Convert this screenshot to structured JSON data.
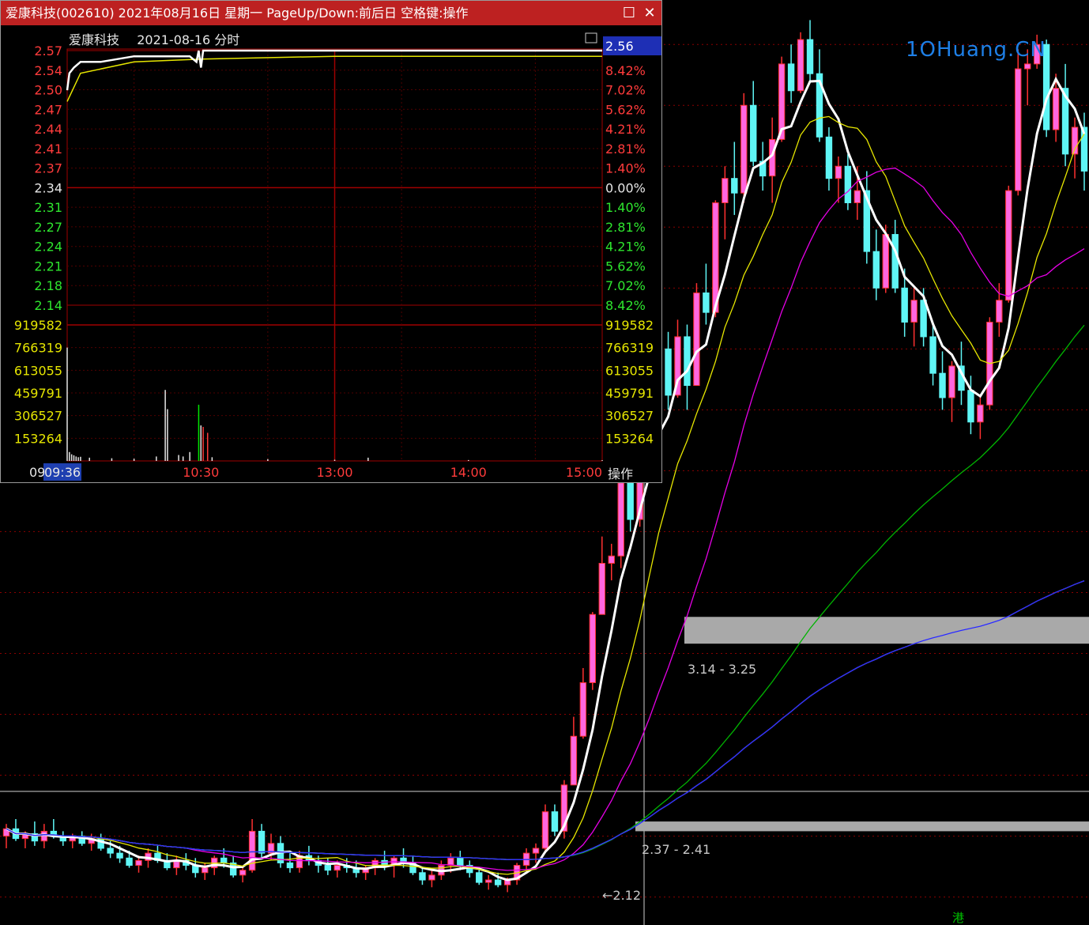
{
  "window": {
    "title": "爱康科技(002610) 2021年08月16日 星期一 PageUp/Down:前后日 空格键:操作",
    "maximize_icon": "maximize-icon",
    "close_icon": "close-icon"
  },
  "intraday": {
    "stock_name": "爱康科技",
    "date_label": "2021-08-16 分时",
    "current_price": "2.56",
    "operate_button": "操作",
    "prev_close": "2.34",
    "price_ticks_left": [
      "2.57",
      "2.54",
      "2.50",
      "2.47",
      "2.44",
      "2.41",
      "2.37",
      "2.34",
      "2.31",
      "2.27",
      "2.24",
      "2.21",
      "2.18",
      "2.14"
    ],
    "pct_ticks_right": [
      "8.42%",
      "7.02%",
      "5.62%",
      "4.21%",
      "2.81%",
      "1.40%",
      "0.00%",
      "1.40%",
      "2.81%",
      "4.21%",
      "5.62%",
      "7.02%",
      "8.42%"
    ],
    "volume_ticks": [
      "919582",
      "766319",
      "613055",
      "459791",
      "306527",
      "153264"
    ],
    "time_ticks": [
      "09",
      "09:36",
      "10:30",
      "13:00",
      "14:00",
      "15:00"
    ]
  },
  "kline": {
    "logo": "1OHuang.CN",
    "labels": {
      "band_high": "3.14 - 3.25",
      "band_low": "2.37 - 2.41",
      "low_marker": "←2.12",
      "hk_marker": "港"
    }
  },
  "colors": {
    "title_bar": "#bd2121",
    "up_candle": "#ff66e0",
    "down_candle": "#5ff5f5",
    "limit_up_candle": "#00e600",
    "grid": "#8b0000",
    "ma5": "#ffffff",
    "ma10": "#e6e600",
    "ma20": "#e600e6",
    "ma60": "#00b400",
    "ma120": "#c8c8c8",
    "ma250": "#2828ff",
    "price_line": "#ffffff",
    "avg_line": "#e6e600"
  },
  "chart_data": [
    {
      "type": "candlestick",
      "title": "",
      "series": [
        {
          "name": "candles",
          "ohlc": [
            [
              2.35,
              2.4,
              2.3,
              2.38
            ],
            [
              2.38,
              2.42,
              2.33,
              2.34
            ],
            [
              2.34,
              2.37,
              2.3,
              2.36
            ],
            [
              2.36,
              2.41,
              2.31,
              2.33
            ],
            [
              2.33,
              2.4,
              2.3,
              2.37
            ],
            [
              2.37,
              2.42,
              2.34,
              2.35
            ],
            [
              2.35,
              2.37,
              2.31,
              2.33
            ],
            [
              2.33,
              2.36,
              2.3,
              2.35
            ],
            [
              2.35,
              2.37,
              2.31,
              2.32
            ],
            [
              2.32,
              2.36,
              2.29,
              2.34
            ],
            [
              2.34,
              2.36,
              2.29,
              2.3
            ],
            [
              2.3,
              2.33,
              2.26,
              2.28
            ],
            [
              2.28,
              2.31,
              2.24,
              2.26
            ],
            [
              2.26,
              2.29,
              2.22,
              2.23
            ],
            [
              2.23,
              2.27,
              2.2,
              2.25
            ],
            [
              2.25,
              2.3,
              2.22,
              2.28
            ],
            [
              2.28,
              2.31,
              2.24,
              2.25
            ],
            [
              2.25,
              2.28,
              2.21,
              2.22
            ],
            [
              2.22,
              2.27,
              2.19,
              2.25
            ],
            [
              2.25,
              2.28,
              2.21,
              2.23
            ],
            [
              2.23,
              2.26,
              2.18,
              2.2
            ],
            [
              2.2,
              2.24,
              2.17,
              2.22
            ],
            [
              2.22,
              2.27,
              2.19,
              2.26
            ],
            [
              2.26,
              2.3,
              2.22,
              2.24
            ],
            [
              2.24,
              2.27,
              2.18,
              2.19
            ],
            [
              2.19,
              2.22,
              2.16,
              2.21
            ],
            [
              2.21,
              2.42,
              2.2,
              2.37
            ],
            [
              2.37,
              2.4,
              2.26,
              2.28
            ],
            [
              2.28,
              2.36,
              2.25,
              2.32
            ],
            [
              2.32,
              2.35,
              2.22,
              2.24
            ],
            [
              2.24,
              2.28,
              2.2,
              2.22
            ],
            [
              2.22,
              2.29,
              2.2,
              2.27
            ],
            [
              2.27,
              2.31,
              2.23,
              2.25
            ],
            [
              2.25,
              2.27,
              2.2,
              2.23
            ],
            [
              2.23,
              2.26,
              2.19,
              2.21
            ],
            [
              2.21,
              2.25,
              2.18,
              2.23
            ],
            [
              2.23,
              2.26,
              2.2,
              2.22
            ],
            [
              2.22,
              2.25,
              2.18,
              2.2
            ],
            [
              2.2,
              2.23,
              2.17,
              2.22
            ],
            [
              2.22,
              2.26,
              2.19,
              2.25
            ],
            [
              2.25,
              2.29,
              2.21,
              2.23
            ],
            [
              2.23,
              2.27,
              2.18,
              2.26
            ],
            [
              2.26,
              2.3,
              2.22,
              2.24
            ],
            [
              2.24,
              2.27,
              2.19,
              2.2
            ],
            [
              2.2,
              2.22,
              2.15,
              2.17
            ],
            [
              2.17,
              2.21,
              2.14,
              2.19
            ],
            [
              2.19,
              2.25,
              2.17,
              2.23
            ],
            [
              2.23,
              2.28,
              2.2,
              2.26
            ],
            [
              2.26,
              2.29,
              2.21,
              2.23
            ],
            [
              2.23,
              2.25,
              2.18,
              2.2
            ],
            [
              2.2,
              2.22,
              2.15,
              2.16
            ],
            [
              2.16,
              2.19,
              2.13,
              2.17
            ],
            [
              2.17,
              2.2,
              2.14,
              2.15
            ],
            [
              2.15,
              2.18,
              2.12,
              2.17
            ],
            [
              2.17,
              2.24,
              2.15,
              2.23
            ],
            [
              2.23,
              2.3,
              2.21,
              2.28
            ],
            [
              2.28,
              2.32,
              2.24,
              2.3
            ],
            [
              2.3,
              2.48,
              2.29,
              2.45
            ],
            [
              2.45,
              2.48,
              2.35,
              2.37
            ],
            [
              2.37,
              2.58,
              2.34,
              2.56
            ],
            [
              2.56,
              2.84,
              2.56,
              2.76
            ],
            [
              2.76,
              3.04,
              2.75,
              2.98
            ],
            [
              2.98,
              3.27,
              2.95,
              3.26
            ],
            [
              3.26,
              3.58,
              3.26,
              3.47
            ],
            [
              3.47,
              3.55,
              3.4,
              3.5
            ],
            [
              3.5,
              3.82,
              3.45,
              3.8
            ],
            [
              3.8,
              3.86,
              3.6,
              3.65
            ],
            [
              3.65,
              4.05,
              3.62,
              4.01
            ],
            [
              4.01,
              4.33,
              3.98,
              4.19
            ],
            [
              4.19,
              4.42,
              4.18,
              4.35
            ],
            [
              4.35,
              4.42,
              4.1,
              4.16
            ],
            [
              4.16,
              4.47,
              4.15,
              4.4
            ],
            [
              4.4,
              4.45,
              4.1,
              4.2
            ],
            [
              4.2,
              4.62,
              4.2,
              4.58
            ],
            [
              4.58,
              4.7,
              4.45,
              4.5
            ],
            [
              4.5,
              4.96,
              4.48,
              4.95
            ],
            [
              4.95,
              5.1,
              4.8,
              5.05
            ],
            [
              5.05,
              5.2,
              4.9,
              4.99
            ],
            [
              4.99,
              5.4,
              4.95,
              5.35
            ],
            [
              5.35,
              5.45,
              5.1,
              5.12
            ],
            [
              5.12,
              5.2,
              5.0,
              5.06
            ],
            [
              5.06,
              5.3,
              4.95,
              5.21
            ],
            [
              5.21,
              5.55,
              5.2,
              5.52
            ],
            [
              5.52,
              5.6,
              5.36,
              5.41
            ],
            [
              5.41,
              5.65,
              5.4,
              5.62
            ],
            [
              5.62,
              5.7,
              5.45,
              5.48
            ],
            [
              5.48,
              5.58,
              5.2,
              5.22
            ],
            [
              5.22,
              5.26,
              5.0,
              5.05
            ],
            [
              5.05,
              5.14,
              4.95,
              5.1
            ],
            [
              5.1,
              5.15,
              4.92,
              4.95
            ],
            [
              4.95,
              5.1,
              4.88,
              5.0
            ],
            [
              5.0,
              5.08,
              4.7,
              4.75
            ],
            [
              4.75,
              4.84,
              4.55,
              4.6
            ],
            [
              4.6,
              4.86,
              4.58,
              4.82
            ],
            [
              4.82,
              4.88,
              4.58,
              4.6
            ],
            [
              4.6,
              4.68,
              4.4,
              4.46
            ],
            [
              4.46,
              4.6,
              4.36,
              4.55
            ],
            [
              4.55,
              4.6,
              4.36,
              4.4
            ],
            [
              4.4,
              4.46,
              4.2,
              4.25
            ],
            [
              4.25,
              4.34,
              4.1,
              4.15
            ],
            [
              4.15,
              4.3,
              4.05,
              4.28
            ],
            [
              4.28,
              4.38,
              4.12,
              4.18
            ],
            [
              4.18,
              4.24,
              4.0,
              4.05
            ],
            [
              4.05,
              4.16,
              3.98,
              4.12
            ],
            [
              4.12,
              4.48,
              4.1,
              4.46
            ],
            [
              4.46,
              4.62,
              4.4,
              4.55
            ],
            [
              4.55,
              5.02,
              4.54,
              5.0
            ],
            [
              5.0,
              5.58,
              4.98,
              5.5
            ],
            [
              5.5,
              5.58,
              5.35,
              5.52
            ],
            [
              5.52,
              5.64,
              5.5,
              5.6
            ],
            [
              5.6,
              5.62,
              5.22,
              5.25
            ],
            [
              5.25,
              5.48,
              5.2,
              5.42
            ],
            [
              5.42,
              5.52,
              5.1,
              5.15
            ],
            [
              5.15,
              5.3,
              5.05,
              5.26
            ],
            [
              5.26,
              5.32,
              5.0,
              5.08
            ]
          ]
        }
      ],
      "moving_averages": [
        {
          "period": 5,
          "color": "#ffffff"
        },
        {
          "period": 10,
          "color": "#e6e600"
        },
        {
          "period": 20,
          "color": "#e600e6"
        },
        {
          "period": 60,
          "color": "#00b400"
        },
        {
          "period": 120,
          "color": "#c8c8c8"
        },
        {
          "period": 250,
          "color": "#2828ff"
        }
      ],
      "price_bands": [
        {
          "low": 3.14,
          "high": 3.25,
          "label": "3.14 - 3.25"
        },
        {
          "low": 2.37,
          "high": 2.41,
          "label": "2.37 - 2.41"
        }
      ],
      "low_marker": 2.12
    },
    {
      "type": "line",
      "title": "爱康科技 2021-08-16 分时",
      "prev_close": 2.34,
      "ylim": [
        2.12,
        2.57
      ],
      "x_ticks": [
        "09:30",
        "10:30",
        "13:00",
        "14:00",
        "15:00"
      ],
      "series": [
        {
          "name": "price",
          "points": [
            [
              "09:30",
              2.5
            ],
            [
              "09:31",
              2.53
            ],
            [
              "09:33",
              2.54
            ],
            [
              "09:36",
              2.55
            ],
            [
              "09:45",
              2.55
            ],
            [
              "10:00",
              2.56
            ],
            [
              "10:15",
              2.56
            ],
            [
              "10:25",
              2.56
            ],
            [
              "10:28",
              2.55
            ],
            [
              "10:29",
              2.57
            ],
            [
              "10:30",
              2.54
            ],
            [
              "10:31",
              2.57
            ],
            [
              "11:30",
              2.57
            ],
            [
              "13:00",
              2.57
            ],
            [
              "15:00",
              2.57
            ]
          ]
        },
        {
          "name": "average",
          "points": [
            [
              "09:30",
              2.48
            ],
            [
              "09:36",
              2.53
            ],
            [
              "10:00",
              2.55
            ],
            [
              "10:30",
              2.555
            ],
            [
              "11:30",
              2.56
            ],
            [
              "13:00",
              2.56
            ],
            [
              "15:00",
              2.56
            ]
          ]
        }
      ],
      "volume": {
        "ylim": [
          0,
          919582
        ],
        "bars": [
          [
            "09:30",
            766319
          ],
          [
            "09:31",
            60000
          ],
          [
            "09:32",
            45000
          ],
          [
            "09:33",
            38000
          ],
          [
            "09:34",
            30000
          ],
          [
            "09:35",
            25000
          ],
          [
            "09:36",
            28000
          ],
          [
            "09:40",
            22000
          ],
          [
            "09:50",
            18000
          ],
          [
            "10:00",
            15000
          ],
          [
            "10:10",
            30000
          ],
          [
            "10:14",
            480000
          ],
          [
            "10:15",
            350000
          ],
          [
            "10:20",
            40000
          ],
          [
            "10:22",
            30000
          ],
          [
            "10:25",
            60000
          ],
          [
            "10:29",
            380000
          ],
          [
            "10:30",
            240000
          ],
          [
            "10:31",
            230000
          ],
          [
            "10:33",
            190000
          ],
          [
            "10:35",
            25000
          ],
          [
            "11:00",
            12000
          ],
          [
            "13:00",
            8000
          ],
          [
            "13:15",
            22000
          ],
          [
            "14:00",
            6000
          ],
          [
            "15:00",
            5000
          ]
        ]
      }
    }
  ]
}
